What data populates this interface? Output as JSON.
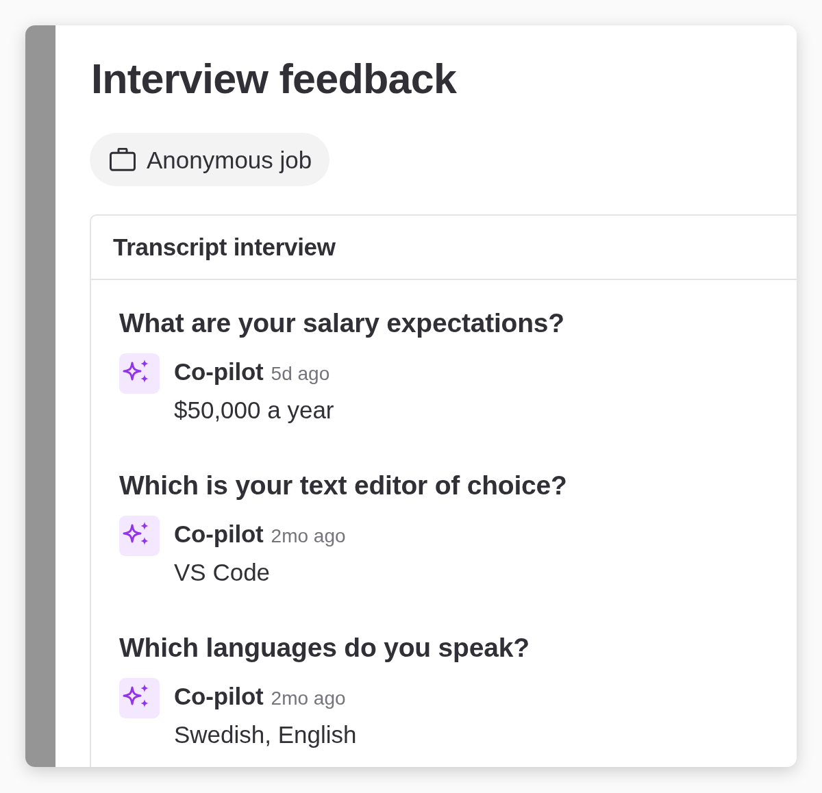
{
  "page": {
    "title": "Interview feedback"
  },
  "job_chip": {
    "label": "Anonymous job"
  },
  "transcript": {
    "title": "Transcript interview",
    "items": [
      {
        "question": "What are your salary expectations?",
        "author": "Co-pilot",
        "time": "5d ago",
        "answer": "$50,000 a year"
      },
      {
        "question": "Which is your text editor of choice?",
        "author": "Co-pilot",
        "time": "2mo ago",
        "answer": "VS Code"
      },
      {
        "question": "Which languages do you speak?",
        "author": "Co-pilot",
        "time": "2mo ago",
        "answer": "Swedish, English"
      }
    ]
  }
}
